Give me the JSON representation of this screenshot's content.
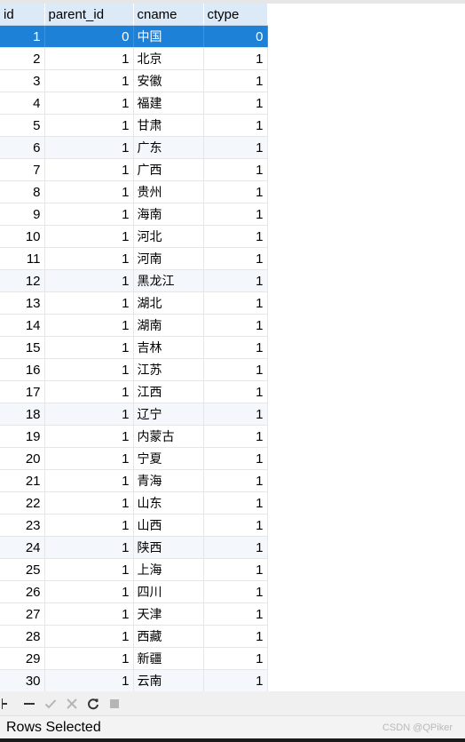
{
  "columns": [
    "id",
    "parent_id",
    "cname",
    "ctype"
  ],
  "rows": [
    {
      "id": "1",
      "parent_id": "0",
      "cname": "中国",
      "ctype": "0",
      "selected": true
    },
    {
      "id": "2",
      "parent_id": "1",
      "cname": "北京",
      "ctype": "1"
    },
    {
      "id": "3",
      "parent_id": "1",
      "cname": "安徽",
      "ctype": "1"
    },
    {
      "id": "4",
      "parent_id": "1",
      "cname": "福建",
      "ctype": "1"
    },
    {
      "id": "5",
      "parent_id": "1",
      "cname": "甘肃",
      "ctype": "1"
    },
    {
      "id": "6",
      "parent_id": "1",
      "cname": "广东",
      "ctype": "1"
    },
    {
      "id": "7",
      "parent_id": "1",
      "cname": "广西",
      "ctype": "1"
    },
    {
      "id": "8",
      "parent_id": "1",
      "cname": "贵州",
      "ctype": "1"
    },
    {
      "id": "9",
      "parent_id": "1",
      "cname": "海南",
      "ctype": "1"
    },
    {
      "id": "10",
      "parent_id": "1",
      "cname": "河北",
      "ctype": "1"
    },
    {
      "id": "11",
      "parent_id": "1",
      "cname": "河南",
      "ctype": "1"
    },
    {
      "id": "12",
      "parent_id": "1",
      "cname": "黑龙江",
      "ctype": "1"
    },
    {
      "id": "13",
      "parent_id": "1",
      "cname": "湖北",
      "ctype": "1"
    },
    {
      "id": "14",
      "parent_id": "1",
      "cname": "湖南",
      "ctype": "1"
    },
    {
      "id": "15",
      "parent_id": "1",
      "cname": "吉林",
      "ctype": "1"
    },
    {
      "id": "16",
      "parent_id": "1",
      "cname": "江苏",
      "ctype": "1"
    },
    {
      "id": "17",
      "parent_id": "1",
      "cname": "江西",
      "ctype": "1"
    },
    {
      "id": "18",
      "parent_id": "1",
      "cname": "辽宁",
      "ctype": "1"
    },
    {
      "id": "19",
      "parent_id": "1",
      "cname": "内蒙古",
      "ctype": "1"
    },
    {
      "id": "20",
      "parent_id": "1",
      "cname": "宁夏",
      "ctype": "1"
    },
    {
      "id": "21",
      "parent_id": "1",
      "cname": "青海",
      "ctype": "1"
    },
    {
      "id": "22",
      "parent_id": "1",
      "cname": "山东",
      "ctype": "1"
    },
    {
      "id": "23",
      "parent_id": "1",
      "cname": "山西",
      "ctype": "1"
    },
    {
      "id": "24",
      "parent_id": "1",
      "cname": "陕西",
      "ctype": "1"
    },
    {
      "id": "25",
      "parent_id": "1",
      "cname": "上海",
      "ctype": "1"
    },
    {
      "id": "26",
      "parent_id": "1",
      "cname": "四川",
      "ctype": "1"
    },
    {
      "id": "27",
      "parent_id": "1",
      "cname": "天津",
      "ctype": "1"
    },
    {
      "id": "28",
      "parent_id": "1",
      "cname": "西藏",
      "ctype": "1"
    },
    {
      "id": "29",
      "parent_id": "1",
      "cname": "新疆",
      "ctype": "1"
    },
    {
      "id": "30",
      "parent_id": "1",
      "cname": "云南",
      "ctype": "1"
    }
  ],
  "toolbar": {
    "buttons": [
      {
        "name": "add-record-icon",
        "enabled": true
      },
      {
        "name": "delete-record-icon",
        "enabled": true
      },
      {
        "name": "apply-changes-icon",
        "enabled": false
      },
      {
        "name": "discard-changes-icon",
        "enabled": false
      },
      {
        "name": "refresh-icon",
        "enabled": true
      },
      {
        "name": "stop-icon",
        "enabled": false
      }
    ]
  },
  "status": {
    "text": "Rows Selected"
  },
  "watermark": "CSDN @QPiker",
  "colors": {
    "selected_row": "#1e81d8",
    "header": "#dce9f7",
    "alt_row": "#f4f8fc"
  }
}
